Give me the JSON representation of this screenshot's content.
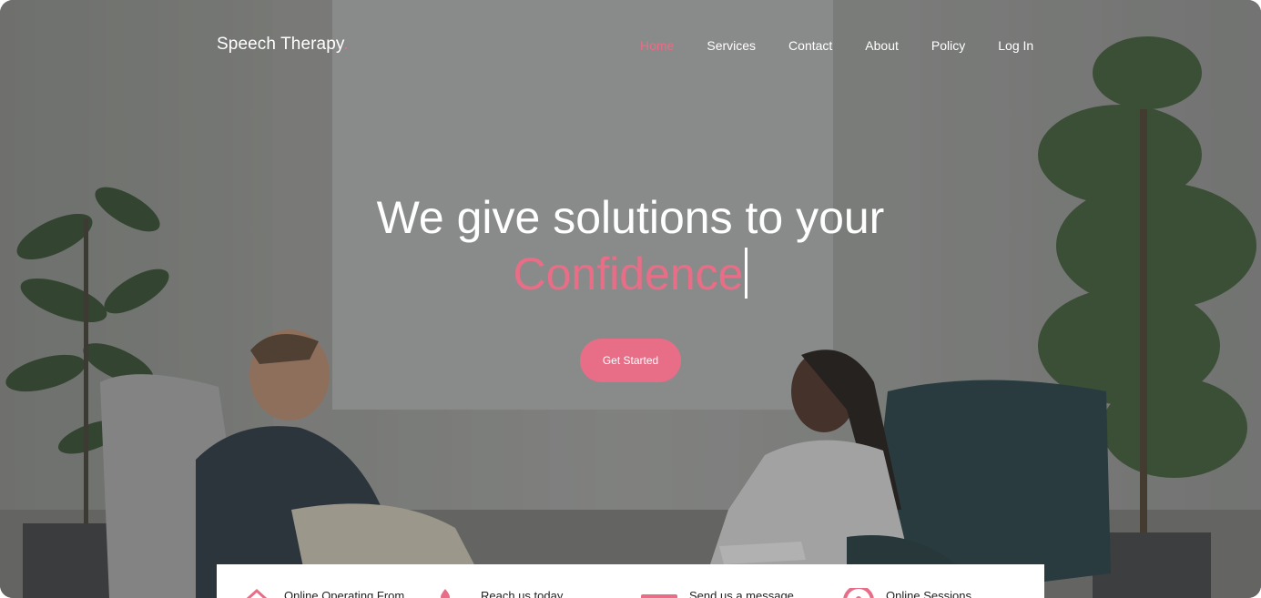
{
  "brand": {
    "name": "Speech Therapy",
    "dot": "."
  },
  "nav": {
    "items": [
      {
        "label": "Home",
        "active": true
      },
      {
        "label": "Services",
        "active": false
      },
      {
        "label": "Contact",
        "active": false
      },
      {
        "label": "About",
        "active": false
      },
      {
        "label": "Policy",
        "active": false
      },
      {
        "label": "Log In",
        "active": false
      }
    ]
  },
  "hero": {
    "line1": "We give solutions to your",
    "line2": "Confidence",
    "cta": "Get Started"
  },
  "info": [
    {
      "label": "Online Operating From",
      "icon": "home-icon"
    },
    {
      "label": "Reach us today",
      "icon": "location-pin-icon"
    },
    {
      "label": "Send us a message",
      "icon": "envelope-icon"
    },
    {
      "label": "Online Sessions",
      "icon": "clock-icon"
    }
  ],
  "colors": {
    "accent": "#e86d87",
    "text_light": "#ffffff"
  }
}
